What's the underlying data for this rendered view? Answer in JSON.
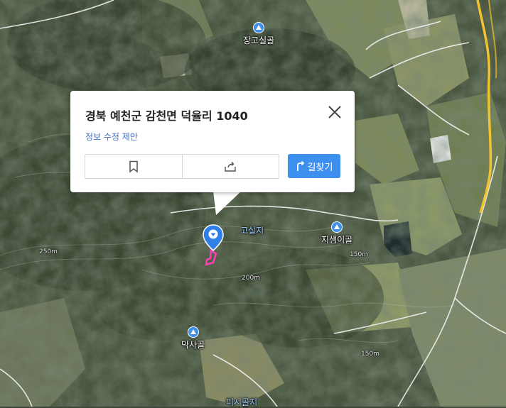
{
  "card": {
    "title": "경북 예천군 감천면 덕율리 1040",
    "edit_link": "정보 수정 제안",
    "route_label": "길찾기",
    "actions": [
      "bookmark-icon",
      "share-icon"
    ]
  },
  "places": [
    {
      "name": "장고실골",
      "icon": "mountain-icon"
    },
    {
      "name": "지샘이골",
      "icon": "mountain-icon"
    },
    {
      "name": "막사골",
      "icon": "mountain-icon"
    }
  ],
  "labels": {
    "gosilji": "고실지",
    "misilgoji": "미시골지"
  },
  "elevations": [
    "250m",
    "200m",
    "150m",
    "150m"
  ],
  "colors": {
    "accent": "#3d8ff0",
    "pin": "#2f7fe8",
    "parcel": "#ff3fb4",
    "highway": "#f2c230"
  }
}
